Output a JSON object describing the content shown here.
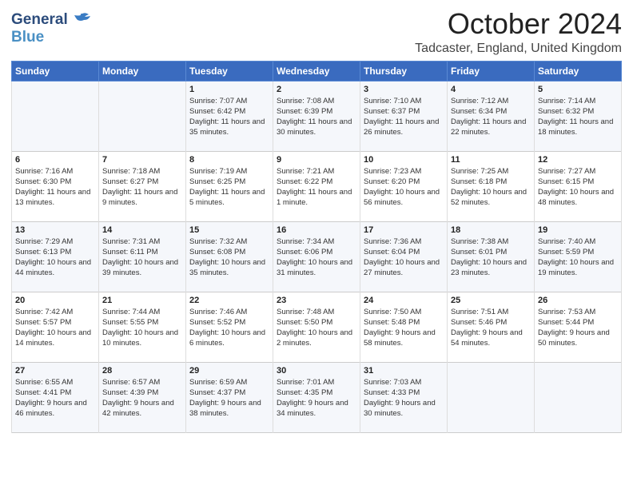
{
  "header": {
    "logo_line1": "General",
    "logo_line2": "Blue",
    "month_title": "October 2024",
    "location": "Tadcaster, England, United Kingdom"
  },
  "days_of_week": [
    "Sunday",
    "Monday",
    "Tuesday",
    "Wednesday",
    "Thursday",
    "Friday",
    "Saturday"
  ],
  "weeks": [
    [
      {
        "day": "",
        "sunrise": "",
        "sunset": "",
        "daylight": ""
      },
      {
        "day": "",
        "sunrise": "",
        "sunset": "",
        "daylight": ""
      },
      {
        "day": "1",
        "sunrise": "Sunrise: 7:07 AM",
        "sunset": "Sunset: 6:42 PM",
        "daylight": "Daylight: 11 hours and 35 minutes."
      },
      {
        "day": "2",
        "sunrise": "Sunrise: 7:08 AM",
        "sunset": "Sunset: 6:39 PM",
        "daylight": "Daylight: 11 hours and 30 minutes."
      },
      {
        "day": "3",
        "sunrise": "Sunrise: 7:10 AM",
        "sunset": "Sunset: 6:37 PM",
        "daylight": "Daylight: 11 hours and 26 minutes."
      },
      {
        "day": "4",
        "sunrise": "Sunrise: 7:12 AM",
        "sunset": "Sunset: 6:34 PM",
        "daylight": "Daylight: 11 hours and 22 minutes."
      },
      {
        "day": "5",
        "sunrise": "Sunrise: 7:14 AM",
        "sunset": "Sunset: 6:32 PM",
        "daylight": "Daylight: 11 hours and 18 minutes."
      }
    ],
    [
      {
        "day": "6",
        "sunrise": "Sunrise: 7:16 AM",
        "sunset": "Sunset: 6:30 PM",
        "daylight": "Daylight: 11 hours and 13 minutes."
      },
      {
        "day": "7",
        "sunrise": "Sunrise: 7:18 AM",
        "sunset": "Sunset: 6:27 PM",
        "daylight": "Daylight: 11 hours and 9 minutes."
      },
      {
        "day": "8",
        "sunrise": "Sunrise: 7:19 AM",
        "sunset": "Sunset: 6:25 PM",
        "daylight": "Daylight: 11 hours and 5 minutes."
      },
      {
        "day": "9",
        "sunrise": "Sunrise: 7:21 AM",
        "sunset": "Sunset: 6:22 PM",
        "daylight": "Daylight: 11 hours and 1 minute."
      },
      {
        "day": "10",
        "sunrise": "Sunrise: 7:23 AM",
        "sunset": "Sunset: 6:20 PM",
        "daylight": "Daylight: 10 hours and 56 minutes."
      },
      {
        "day": "11",
        "sunrise": "Sunrise: 7:25 AM",
        "sunset": "Sunset: 6:18 PM",
        "daylight": "Daylight: 10 hours and 52 minutes."
      },
      {
        "day": "12",
        "sunrise": "Sunrise: 7:27 AM",
        "sunset": "Sunset: 6:15 PM",
        "daylight": "Daylight: 10 hours and 48 minutes."
      }
    ],
    [
      {
        "day": "13",
        "sunrise": "Sunrise: 7:29 AM",
        "sunset": "Sunset: 6:13 PM",
        "daylight": "Daylight: 10 hours and 44 minutes."
      },
      {
        "day": "14",
        "sunrise": "Sunrise: 7:31 AM",
        "sunset": "Sunset: 6:11 PM",
        "daylight": "Daylight: 10 hours and 39 minutes."
      },
      {
        "day": "15",
        "sunrise": "Sunrise: 7:32 AM",
        "sunset": "Sunset: 6:08 PM",
        "daylight": "Daylight: 10 hours and 35 minutes."
      },
      {
        "day": "16",
        "sunrise": "Sunrise: 7:34 AM",
        "sunset": "Sunset: 6:06 PM",
        "daylight": "Daylight: 10 hours and 31 minutes."
      },
      {
        "day": "17",
        "sunrise": "Sunrise: 7:36 AM",
        "sunset": "Sunset: 6:04 PM",
        "daylight": "Daylight: 10 hours and 27 minutes."
      },
      {
        "day": "18",
        "sunrise": "Sunrise: 7:38 AM",
        "sunset": "Sunset: 6:01 PM",
        "daylight": "Daylight: 10 hours and 23 minutes."
      },
      {
        "day": "19",
        "sunrise": "Sunrise: 7:40 AM",
        "sunset": "Sunset: 5:59 PM",
        "daylight": "Daylight: 10 hours and 19 minutes."
      }
    ],
    [
      {
        "day": "20",
        "sunrise": "Sunrise: 7:42 AM",
        "sunset": "Sunset: 5:57 PM",
        "daylight": "Daylight: 10 hours and 14 minutes."
      },
      {
        "day": "21",
        "sunrise": "Sunrise: 7:44 AM",
        "sunset": "Sunset: 5:55 PM",
        "daylight": "Daylight: 10 hours and 10 minutes."
      },
      {
        "day": "22",
        "sunrise": "Sunrise: 7:46 AM",
        "sunset": "Sunset: 5:52 PM",
        "daylight": "Daylight: 10 hours and 6 minutes."
      },
      {
        "day": "23",
        "sunrise": "Sunrise: 7:48 AM",
        "sunset": "Sunset: 5:50 PM",
        "daylight": "Daylight: 10 hours and 2 minutes."
      },
      {
        "day": "24",
        "sunrise": "Sunrise: 7:50 AM",
        "sunset": "Sunset: 5:48 PM",
        "daylight": "Daylight: 9 hours and 58 minutes."
      },
      {
        "day": "25",
        "sunrise": "Sunrise: 7:51 AM",
        "sunset": "Sunset: 5:46 PM",
        "daylight": "Daylight: 9 hours and 54 minutes."
      },
      {
        "day": "26",
        "sunrise": "Sunrise: 7:53 AM",
        "sunset": "Sunset: 5:44 PM",
        "daylight": "Daylight: 9 hours and 50 minutes."
      }
    ],
    [
      {
        "day": "27",
        "sunrise": "Sunrise: 6:55 AM",
        "sunset": "Sunset: 4:41 PM",
        "daylight": "Daylight: 9 hours and 46 minutes."
      },
      {
        "day": "28",
        "sunrise": "Sunrise: 6:57 AM",
        "sunset": "Sunset: 4:39 PM",
        "daylight": "Daylight: 9 hours and 42 minutes."
      },
      {
        "day": "29",
        "sunrise": "Sunrise: 6:59 AM",
        "sunset": "Sunset: 4:37 PM",
        "daylight": "Daylight: 9 hours and 38 minutes."
      },
      {
        "day": "30",
        "sunrise": "Sunrise: 7:01 AM",
        "sunset": "Sunset: 4:35 PM",
        "daylight": "Daylight: 9 hours and 34 minutes."
      },
      {
        "day": "31",
        "sunrise": "Sunrise: 7:03 AM",
        "sunset": "Sunset: 4:33 PM",
        "daylight": "Daylight: 9 hours and 30 minutes."
      },
      {
        "day": "",
        "sunrise": "",
        "sunset": "",
        "daylight": ""
      },
      {
        "day": "",
        "sunrise": "",
        "sunset": "",
        "daylight": ""
      }
    ]
  ]
}
